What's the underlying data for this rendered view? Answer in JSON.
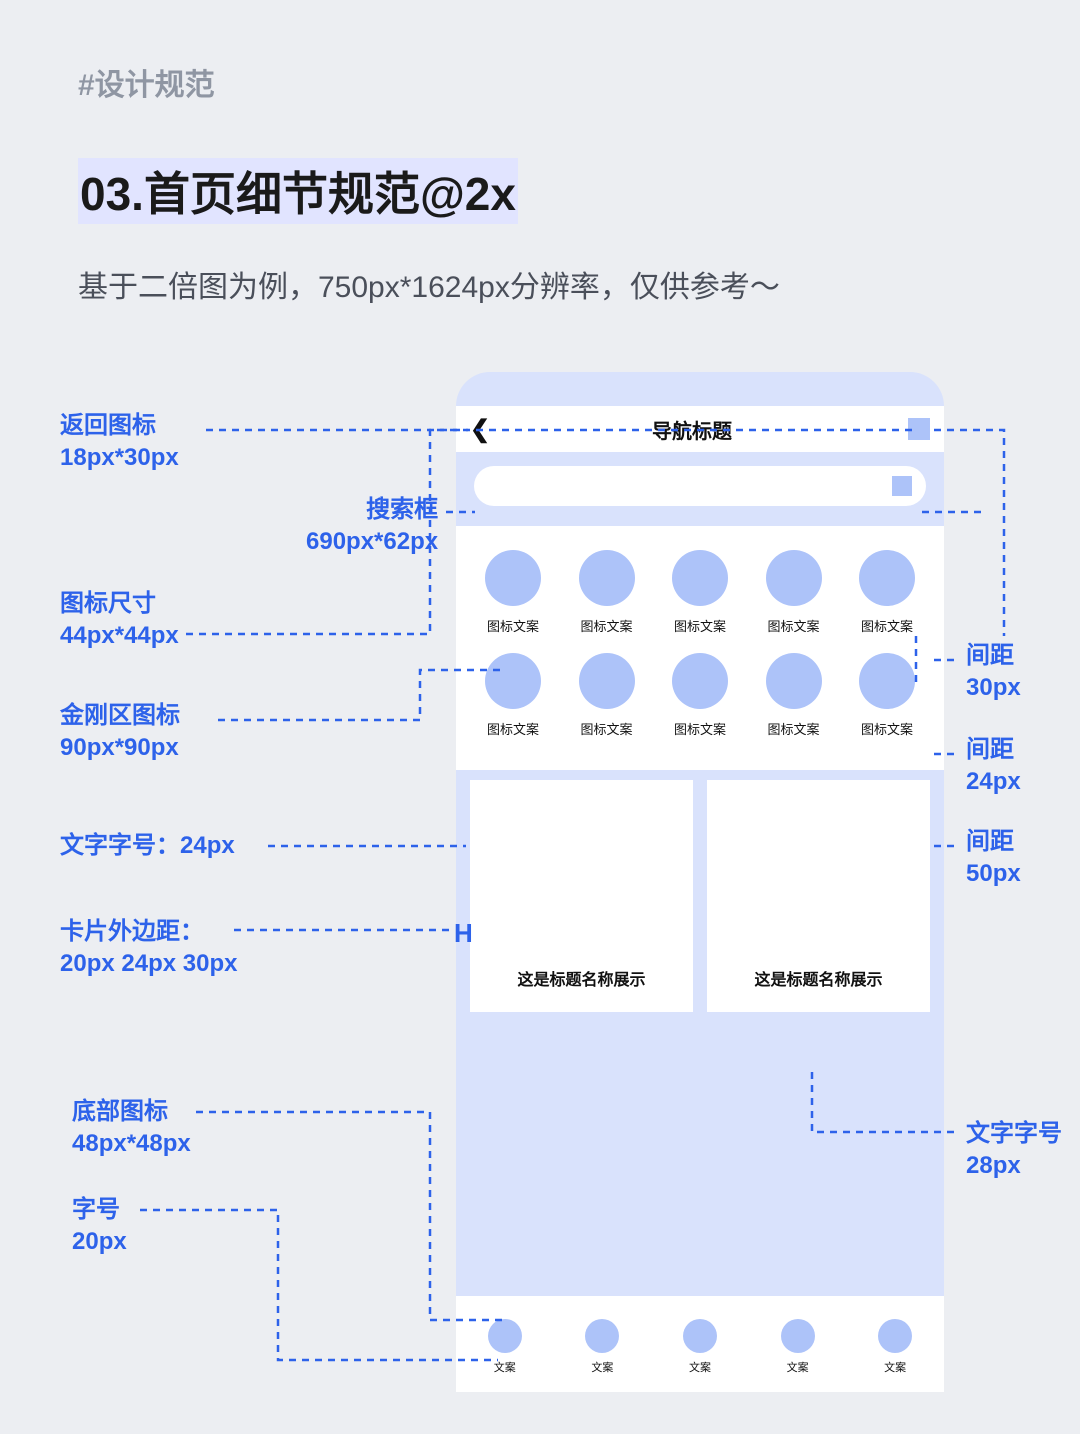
{
  "hashtag": "#设计规范",
  "title": "03.首页细节规范@2x",
  "subtitle": "基于二倍图为例，750px*1624px分辨率，仅供参考～",
  "phone": {
    "nav_title": "导航标题",
    "icon_label": "图标文案",
    "card_title": "这是标题名称展示",
    "tab_label": "文案"
  },
  "annotations": {
    "back_icon": {
      "label": "返回图标",
      "size": "18px*30px"
    },
    "search_box": {
      "label": "搜索框",
      "size": "690px*62px"
    },
    "icon_size": {
      "label": "图标尺寸",
      "size": "44px*44px"
    },
    "kingkong_icon": {
      "label": "金刚区图标",
      "size": "90px*90px"
    },
    "text_size": {
      "label": "文字字号：24px"
    },
    "card_margin": {
      "label": "卡片外边距：",
      "size": "20px 24px 30px"
    },
    "bottom_icon": {
      "label": "底部图标",
      "size": "48px*48px"
    },
    "bottom_font": {
      "label": "字号",
      "size": "20px"
    },
    "gap_30": {
      "label": "间距",
      "size": "30px"
    },
    "gap_24": {
      "label": "间距",
      "size": "24px"
    },
    "gap_50": {
      "label": "间距",
      "size": "50px"
    },
    "card_font": {
      "label": "文字字号",
      "size": "28px"
    }
  }
}
